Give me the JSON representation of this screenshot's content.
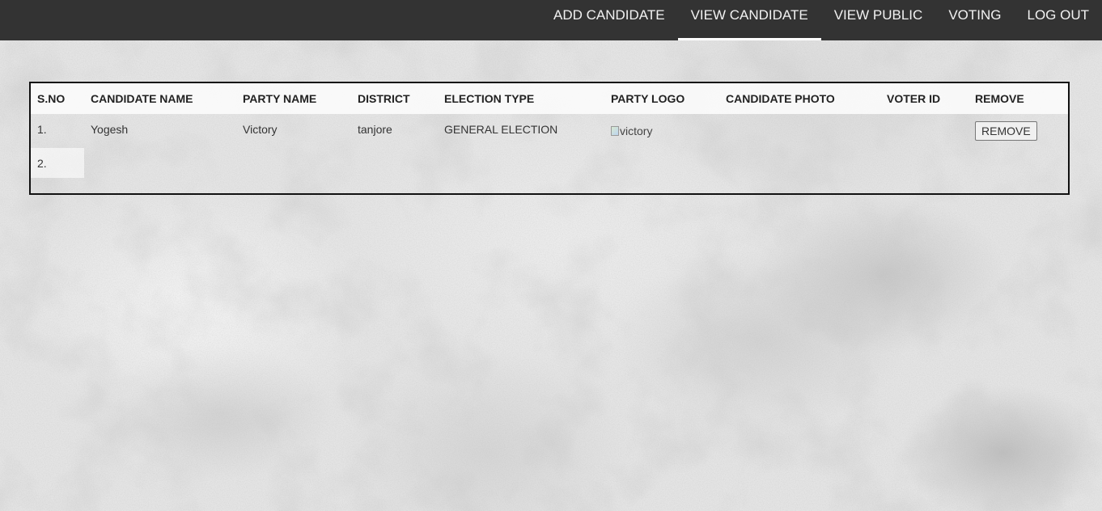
{
  "nav": {
    "items": [
      {
        "label": "ADD CANDIDATE",
        "active": false
      },
      {
        "label": "VIEW CANDIDATE",
        "active": true
      },
      {
        "label": "VIEW PUBLIC",
        "active": false
      },
      {
        "label": "VOTING",
        "active": false
      },
      {
        "label": "LOG OUT",
        "active": false
      }
    ]
  },
  "table": {
    "headers": [
      "S.NO",
      "CANDIDATE NAME",
      "PARTY NAME",
      "DISTRICT",
      "ELECTION TYPE",
      "PARTY LOGO",
      "CANDIDATE PHOTO",
      "VOTER ID",
      "REMOVE"
    ],
    "rows": [
      {
        "sno": "1.",
        "candidate_name": "Yogesh",
        "party_name": "Victory",
        "district": "tanjore",
        "election_type": "GENERAL ELECTION",
        "party_logo_alt": "victory",
        "candidate_photo": "",
        "voter_id": "",
        "remove_label": "REMOVE"
      },
      {
        "sno": "2."
      }
    ]
  },
  "colors": {
    "navbar_bg": "#333333",
    "nav_text": "#f2f2f2",
    "table_border": "#111111"
  }
}
